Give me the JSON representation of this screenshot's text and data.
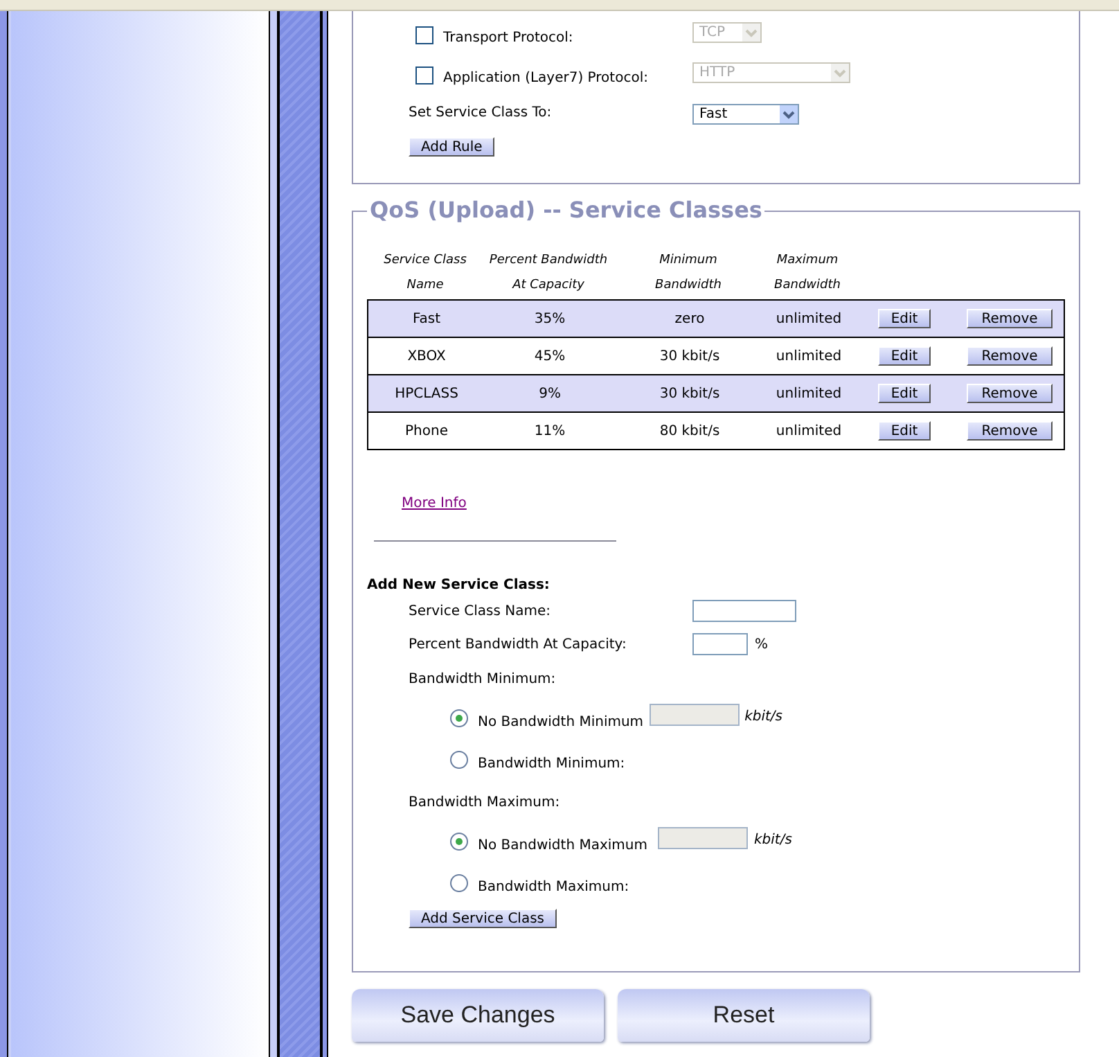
{
  "rule_form": {
    "fields": [
      {
        "kind": "checkbox-select",
        "label": "Transport Protocol:",
        "checked": false,
        "value": "TCP",
        "disabled": true
      },
      {
        "kind": "checkbox-select",
        "label": "Application (Layer7) Protocol:",
        "checked": false,
        "value": "HTTP",
        "disabled": true
      },
      {
        "kind": "select",
        "label": "Set Service Class To:",
        "value": "Fast",
        "disabled": false
      }
    ],
    "button": "Add Rule"
  },
  "service_classes": {
    "title": "QoS (Upload) -- Service Classes",
    "columns": [
      {
        "lines": [
          "Service Class",
          "Name"
        ]
      },
      {
        "lines": [
          "Percent Bandwidth",
          "At Capacity"
        ]
      },
      {
        "lines": [
          "Minimum",
          "Bandwidth"
        ]
      },
      {
        "lines": [
          "Maximum",
          "Bandwidth"
        ]
      }
    ],
    "rows": [
      {
        "name": "Fast",
        "percent": "35%",
        "minimum": "zero",
        "maximum": "unlimited",
        "highlighted": true,
        "edit": "Edit",
        "remove": "Remove"
      },
      {
        "name": "XBOX",
        "percent": "45%",
        "minimum": "30 kbit/s",
        "maximum": "unlimited",
        "highlighted": false,
        "edit": "Edit",
        "remove": "Remove"
      },
      {
        "name": "HPCLASS",
        "percent": "9%",
        "minimum": "30 kbit/s",
        "maximum": "unlimited",
        "highlighted": true,
        "edit": "Edit",
        "remove": "Remove"
      },
      {
        "name": "Phone",
        "percent": "11%",
        "minimum": "80 kbit/s",
        "maximum": "unlimited",
        "highlighted": false,
        "edit": "Edit",
        "remove": "Remove"
      }
    ],
    "more_info": "More Info",
    "add_class": {
      "heading": "Add New Service Class:",
      "name_field": {
        "label": "Service Class Name:"
      },
      "percent_field": {
        "label": "Percent Bandwidth At Capacity:",
        "unit": "%"
      },
      "groups": [
        {
          "label": "Bandwidth Minimum:",
          "options": [
            {
              "label": "No Bandwidth Minimum",
              "selected": true,
              "unit": "kbit/s"
            },
            {
              "label": "Bandwidth Minimum:",
              "selected": false
            }
          ]
        },
        {
          "label": "Bandwidth Maximum:",
          "options": [
            {
              "label": "No Bandwidth Maximum",
              "selected": true,
              "unit": "kbit/s"
            },
            {
              "label": "Bandwidth Maximum:",
              "selected": false
            }
          ]
        }
      ],
      "button": "Add Service Class"
    }
  },
  "footer_buttons": [
    "Save Changes",
    "Reset"
  ]
}
